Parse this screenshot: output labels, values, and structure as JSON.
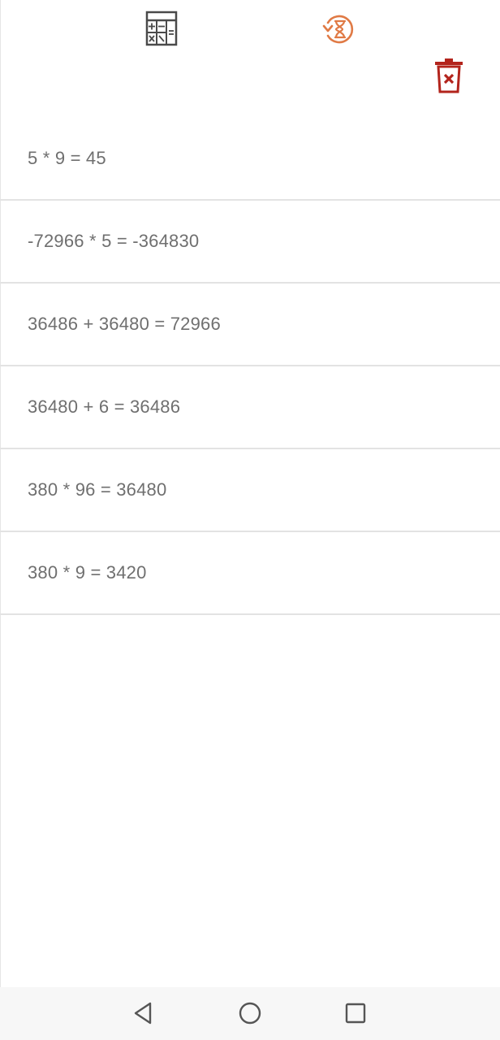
{
  "toolbar": {
    "calculator_icon": "calculator-icon",
    "history_icon": "history-icon",
    "delete_icon": "trash-icon",
    "history_color": "#e07a45",
    "delete_color": "#b3241c",
    "calculator_color": "#4a4a4a"
  },
  "history": {
    "items": [
      {
        "expression": "5 * 9 = 45"
      },
      {
        "expression": "-72966 * 5 = -364830"
      },
      {
        "expression": "36486 + 36480 = 72966"
      },
      {
        "expression": "36480 + 6 = 36486"
      },
      {
        "expression": "380 * 96 = 36480"
      },
      {
        "expression": "380 * 9 = 3420"
      }
    ]
  },
  "navigation": {
    "back_icon": "back-triangle-icon",
    "home_icon": "home-circle-icon",
    "recents_icon": "recents-square-icon"
  }
}
